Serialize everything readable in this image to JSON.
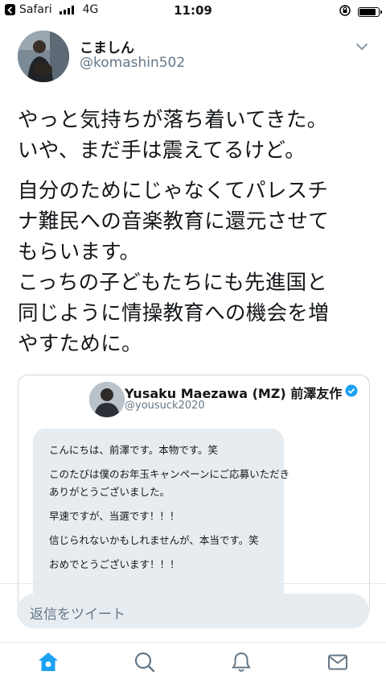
{
  "status_bar": {
    "carrier": "Safari",
    "network": "4G",
    "time": "11:09"
  },
  "tweet": {
    "display_name": "こましん",
    "handle": "@komashin502",
    "lines": [
      "やっと気持ちが落ち着いてきた。",
      "いや、まだ手は震えてるけど。",
      "",
      "自分のためにじゃなくてパレスチ",
      "ナ難民への音楽教育に還元させて",
      "もらいます。",
      "こっちの子どもたちにも先進国と",
      "同じように情操教育への機会を増",
      "やすために。"
    ]
  },
  "quoted": {
    "display_name": "Yusaku Maezawa (MZ) 前澤友作",
    "handle": "@yousuck2020",
    "verified": true,
    "message_lines": [
      "こんにちは、前澤です。本物です。笑",
      "このたびは僕のお年玉キャンペーンにご応募いただき",
      "ありがとうございました。",
      "早速ですが、当選です！！！",
      "信じられないかもしれませんが、本当です。笑",
      "おめでとうございます！！！"
    ]
  },
  "reply": {
    "placeholder": "返信をツイート"
  },
  "tabs": [
    {
      "icon": "home-icon",
      "active": true
    },
    {
      "icon": "search-icon",
      "active": false
    },
    {
      "icon": "notifications-icon",
      "active": false
    },
    {
      "icon": "messages-icon",
      "active": false
    }
  ],
  "colors": {
    "accent": "#1da1f2",
    "secondary_text": "#657786",
    "bubble": "#e6ecf0"
  }
}
